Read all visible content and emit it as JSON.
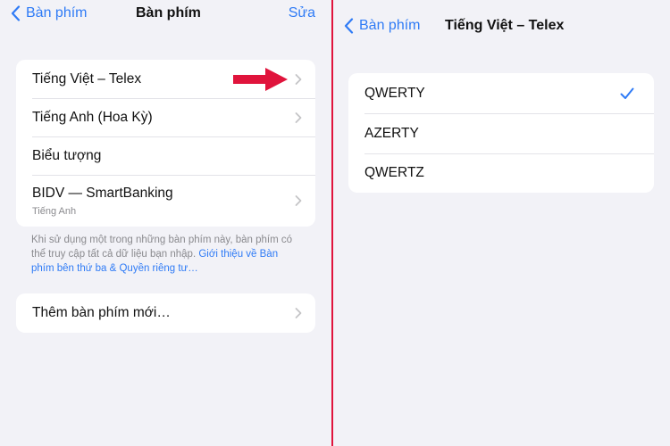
{
  "left": {
    "nav": {
      "back_label": "Bàn phím",
      "title": "Bàn phím",
      "action": "Sửa"
    },
    "keyboards": [
      {
        "label": "Tiếng Việt – Telex"
      },
      {
        "label": "Tiếng Anh (Hoa Kỳ)"
      },
      {
        "label": "Biểu tượng"
      },
      {
        "label": "BIDV — SmartBanking",
        "sublabel": "Tiếng Anh"
      }
    ],
    "footnote": {
      "text": "Khi sử dụng một trong những bàn phím này, bàn phím có thể truy cập tất cả dữ liệu bạn nhập. ",
      "link": "Giới thiệu về Bàn phím bên thứ ba & Quyền riêng tư…"
    },
    "add_keyboard_label": "Thêm bàn phím mới…"
  },
  "right": {
    "nav": {
      "back_label": "Bàn phím",
      "title": "Tiếng Việt – Telex"
    },
    "layouts": [
      {
        "label": "QWERTY",
        "selected": true
      },
      {
        "label": "AZERTY",
        "selected": false
      },
      {
        "label": "QWERTZ",
        "selected": false
      }
    ]
  },
  "colors": {
    "accent": "#2f7bf6",
    "annotation_arrow": "#e0143c",
    "divider": "#e0143c"
  },
  "icons": {
    "back": "chevron-left-icon",
    "disclosure": "chevron-right-icon",
    "selected": "checkmark-icon",
    "annotation": "red-arrow-icon"
  }
}
